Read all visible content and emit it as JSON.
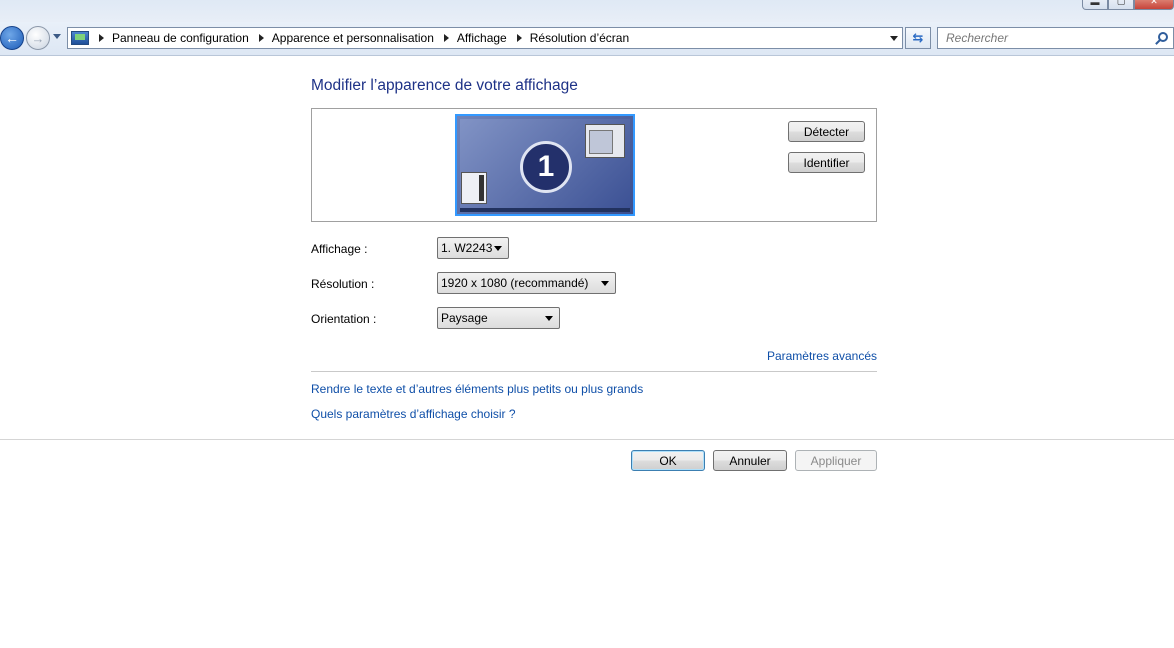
{
  "window": {
    "minimize": "▬",
    "maximize": "▢",
    "close": "✕"
  },
  "breadcrumb": [
    "Panneau de configuration",
    "Apparence et personnalisation",
    "Affichage",
    "Résolution d’écran"
  ],
  "search": {
    "placeholder": "Rechercher"
  },
  "heading": "Modifier l’apparence de votre affichage",
  "monitor": {
    "number": "1"
  },
  "buttons": {
    "detect": "Détecter",
    "identify": "Identifier",
    "ok": "OK",
    "cancel": "Annuler",
    "apply": "Appliquer"
  },
  "settings": {
    "display": {
      "label": "Affichage :",
      "value": "1. W2243"
    },
    "resolution": {
      "label": "Résolution :",
      "value": "1920 x 1080 (recommandé)"
    },
    "orientation": {
      "label": "Orientation :",
      "value": "Paysage"
    }
  },
  "links": {
    "advanced": "Paramètres avancés",
    "text_size": "Rendre le texte et d’autres éléments plus petits ou plus grands",
    "which_settings": "Quels paramètres d’affichage choisir ?"
  }
}
